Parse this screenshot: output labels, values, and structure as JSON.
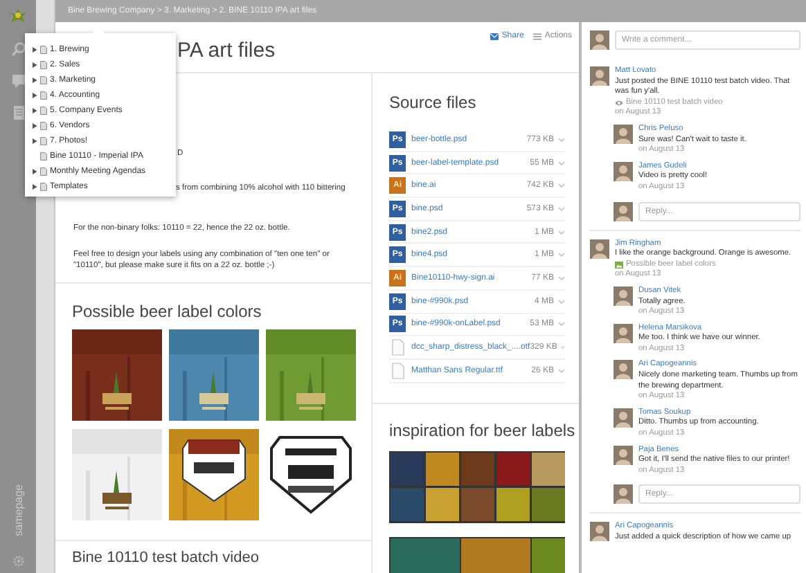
{
  "breadcrumb": "Bine Brewing Company > 3. Marketing > 2. BINE 10110 IPA art files",
  "rail": {
    "brand": "samepage"
  },
  "page": {
    "title": "PA art files",
    "share": "Share",
    "actions": "Actions"
  },
  "description": {
    "fragments": [
      "D",
      "s from combining 10% alcohol with 110 bittering"
    ],
    "paragraphs": [
      "For the non-binary folks: 10110 = 22, hence the 22 oz. bottle.",
      "Feel free to design your labels using any combination of \"ten one ten\" or \"10110\", but please make sure it fits on a 22 oz. bottle ;-)"
    ]
  },
  "label_colors": {
    "title": "Possible beer label colors"
  },
  "video": {
    "title": "Bine 10110 test batch video"
  },
  "source_files": {
    "title": "Source files",
    "files": [
      {
        "kind": "ps",
        "badge": "Ps",
        "name": "beer-bottle.psd",
        "size": "773 KB"
      },
      {
        "kind": "ps",
        "badge": "Ps",
        "name": "beer-label-template.psd",
        "size": "55 MB"
      },
      {
        "kind": "ai",
        "badge": "Ai",
        "name": "bine.ai",
        "size": "742 KB"
      },
      {
        "kind": "ps",
        "badge": "Ps",
        "name": "bine.psd",
        "size": "573 KB"
      },
      {
        "kind": "ps",
        "badge": "Ps",
        "name": "bine2.psd",
        "size": "1 MB"
      },
      {
        "kind": "ps",
        "badge": "Ps",
        "name": "bine4.psd",
        "size": "1 MB"
      },
      {
        "kind": "ai",
        "badge": "Ai",
        "name": "Bine10110-hwy-sign.ai",
        "size": "77 KB"
      },
      {
        "kind": "ps",
        "badge": "Ps",
        "name": "bine-#990k.psd",
        "size": "4 MB"
      },
      {
        "kind": "ps",
        "badge": "Ps",
        "name": "bine-#990k-onLabel.psd",
        "size": "53 MB"
      },
      {
        "kind": "doc",
        "name": "dcc_sharp_distress_black_....otf",
        "size": "329 KB"
      },
      {
        "kind": "doc",
        "name": "Matthan Sans Regular.ttf",
        "size": "26 KB"
      }
    ]
  },
  "inspiration": {
    "title": "inspiration for beer labels"
  },
  "tree_menu": [
    {
      "label": "1. Brewing",
      "expandable": true
    },
    {
      "label": "2. Sales",
      "expandable": true
    },
    {
      "label": "3. Marketing",
      "expandable": true
    },
    {
      "label": "4. Accounting",
      "expandable": true
    },
    {
      "label": "5. Company Events",
      "expandable": true
    },
    {
      "label": "6. Vendors",
      "expandable": true
    },
    {
      "label": "7. Photos!",
      "expandable": true
    },
    {
      "label": "Bine 10110 - Imperial IPA",
      "expandable": false
    },
    {
      "label": "Monthly Meeting Agendas",
      "expandable": true
    },
    {
      "label": "Templates",
      "expandable": true
    }
  ],
  "comments": {
    "placeholder": "Write a comment...",
    "threads": [
      {
        "author": "Matt Lovato",
        "text": "Just posted the BINE 10110 test batch video. That was fun y'all.",
        "attachment": {
          "kind": "video",
          "label": "Bine 10110 test batch video"
        },
        "date": "on August 13",
        "reply_placeholder": "Reply...",
        "replies": [
          {
            "author": "Chris Peluso",
            "text": "Sure was! Can't wait to taste it.",
            "date": "on August 13"
          },
          {
            "author": "James Gudeli",
            "text": "Video is pretty cool!",
            "date": "on August 13"
          }
        ]
      },
      {
        "author": "Jim Ringham",
        "text": "I like the orange background. Orange is awesome.",
        "attachment": {
          "kind": "images",
          "label": "Possible beer label colors"
        },
        "date": "on August 13",
        "reply_placeholder": "Reply...",
        "replies": [
          {
            "author": "Dusan Vitek",
            "text": "Totally agree.",
            "date": "on August 13"
          },
          {
            "author": "Helena Marsikova",
            "text": "Me too. I think we have our winner.",
            "date": "on August 13"
          },
          {
            "author": "Ari Capogeannis",
            "text": "Nicely done marketing team. Thumbs up from the brewing department.",
            "date": "on August 13"
          },
          {
            "author": "Tomas Soukup",
            "text": "Ditto. Thumbs up from accounting.",
            "date": "on August 13"
          },
          {
            "author": "Paja Benes",
            "text": "Got it, I'll send the native files to our printer!",
            "date": "on August 13"
          }
        ]
      },
      {
        "author": "Ari Capogeannis",
        "text": "Just added a quick description of how we came up"
      }
    ]
  }
}
